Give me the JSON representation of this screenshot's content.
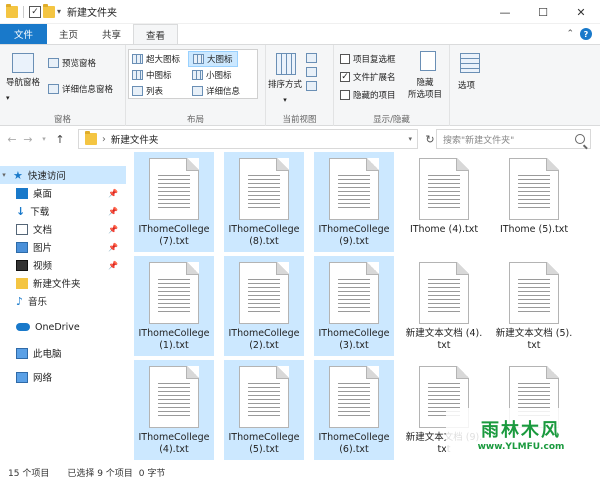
{
  "window": {
    "title": "新建文件夹",
    "controls": {
      "minimize": "—",
      "maximize": "☐",
      "close": "✕"
    }
  },
  "tabs": [
    {
      "label": "文件"
    },
    {
      "label": "主页"
    },
    {
      "label": "共享"
    },
    {
      "label": "查看"
    }
  ],
  "ribbon": {
    "pane_group": {
      "nav_pane": "导航窗格",
      "preview_pane": "预览窗格",
      "details_pane": "详细信息窗格",
      "label": "窗格"
    },
    "layout_group": {
      "xl_icons": "超大图标",
      "l_icons": "大图标",
      "m_icons": "中图标",
      "s_icons": "小图标",
      "list": "列表",
      "details": "详细信息",
      "label": "布局"
    },
    "view_group": {
      "sort": "排序方式",
      "label": "当前视图"
    },
    "show_group": {
      "item_checkbox": "项目复选框",
      "file_ext": "文件扩展名",
      "hidden_items": "隐藏的项目",
      "hide_selected_1": "隐藏",
      "hide_selected_2": "所选项目",
      "label": "显示/隐藏"
    },
    "options": "选项"
  },
  "address": {
    "path": "新建文件夹",
    "search_placeholder": "搜索\"新建文件夹\""
  },
  "nav": [
    {
      "label": "快速访问"
    },
    {
      "label": "桌面"
    },
    {
      "label": "下载"
    },
    {
      "label": "文档"
    },
    {
      "label": "图片"
    },
    {
      "label": "视频"
    },
    {
      "label": "新建文件夹"
    },
    {
      "label": "音乐"
    },
    {
      "label": "OneDrive"
    },
    {
      "label": "此电脑"
    },
    {
      "label": "网络"
    }
  ],
  "files": [
    {
      "name": "IThomeCollege (7).txt",
      "selected": true
    },
    {
      "name": "IThomeCollege (8).txt",
      "selected": true
    },
    {
      "name": "IThomeCollege (9).txt",
      "selected": true
    },
    {
      "name": "IThome (4).txt",
      "selected": false
    },
    {
      "name": "IThome (5).txt",
      "selected": false
    },
    {
      "name": "IThomeCollege (1).txt",
      "selected": true
    },
    {
      "name": "IThomeCollege (2).txt",
      "selected": true
    },
    {
      "name": "IThomeCollege (3).txt",
      "selected": true
    },
    {
      "name": "新建文本文档 (4).txt",
      "selected": false
    },
    {
      "name": "新建文本文档 (5).txt",
      "selected": false
    },
    {
      "name": "IThomeCollege (4).txt",
      "selected": true
    },
    {
      "name": "IThomeCollege (5).txt",
      "selected": true
    },
    {
      "name": "IThomeCollege (6).txt",
      "selected": true
    },
    {
      "name": "新建文本文档 (9).txt",
      "selected": false
    },
    {
      "name": "",
      "selected": false
    }
  ],
  "status": {
    "count": "15 个项目",
    "selected": "已选择 9 个项目",
    "size": "0 字节"
  },
  "watermark": {
    "title": "雨林木风",
    "url": "www.YLMFU.com"
  }
}
